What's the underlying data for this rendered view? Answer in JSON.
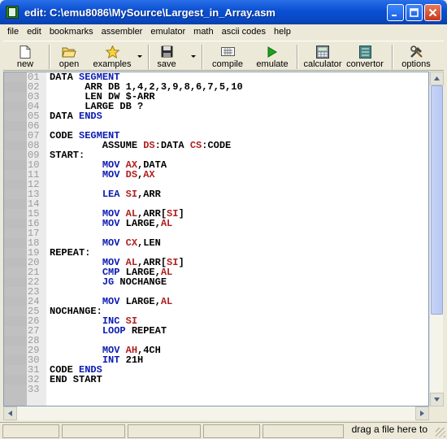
{
  "window": {
    "title": "edit: C:\\emu8086\\MySource\\Largest_in_Array.asm"
  },
  "menu": [
    "file",
    "edit",
    "bookmarks",
    "assembler",
    "emulator",
    "math",
    "ascii codes",
    "help"
  ],
  "toolbar": {
    "new": "new",
    "open": "open",
    "examples": "examples",
    "save": "save",
    "compile": "compile",
    "emulate": "emulate",
    "calculator": "calculator",
    "convertor": "convertor",
    "options": "options"
  },
  "editor": {
    "line_numbers": [
      "01",
      "02",
      "03",
      "04",
      "05",
      "06",
      "07",
      "08",
      "09",
      "10",
      "11",
      "12",
      "13",
      "14",
      "15",
      "16",
      "17",
      "18",
      "19",
      "20",
      "21",
      "22",
      "23",
      "24",
      "25",
      "26",
      "27",
      "28",
      "29",
      "30",
      "31",
      "32",
      "33"
    ],
    "lines": [
      [
        {
          "t": "DATA ",
          "c": ""
        },
        {
          "t": "SEGMENT",
          "c": "blue"
        }
      ],
      [
        {
          "t": "      ARR DB 1,4,2,3,9,8,6,7,5,10",
          "c": ""
        }
      ],
      [
        {
          "t": "      LEN DW $-ARR",
          "c": ""
        }
      ],
      [
        {
          "t": "      LARGE DB ?",
          "c": ""
        }
      ],
      [
        {
          "t": "DATA ",
          "c": ""
        },
        {
          "t": "ENDS",
          "c": "blue"
        }
      ],
      [],
      [
        {
          "t": "CODE ",
          "c": ""
        },
        {
          "t": "SEGMENT",
          "c": "blue"
        }
      ],
      [
        {
          "t": "         ASSUME ",
          "c": ""
        },
        {
          "t": "DS",
          "c": "red"
        },
        {
          "t": ":DATA ",
          "c": ""
        },
        {
          "t": "CS",
          "c": "red"
        },
        {
          "t": ":CODE",
          "c": ""
        }
      ],
      [
        {
          "t": "START:",
          "c": ""
        }
      ],
      [
        {
          "t": "         ",
          "c": ""
        },
        {
          "t": "MOV",
          "c": "blue"
        },
        {
          "t": " ",
          "c": ""
        },
        {
          "t": "AX",
          "c": "red"
        },
        {
          "t": ",DATA",
          "c": ""
        }
      ],
      [
        {
          "t": "         ",
          "c": ""
        },
        {
          "t": "MOV",
          "c": "blue"
        },
        {
          "t": " ",
          "c": ""
        },
        {
          "t": "DS",
          "c": "red"
        },
        {
          "t": ",",
          "c": ""
        },
        {
          "t": "AX",
          "c": "red"
        }
      ],
      [],
      [
        {
          "t": "         ",
          "c": ""
        },
        {
          "t": "LEA",
          "c": "blue"
        },
        {
          "t": " ",
          "c": ""
        },
        {
          "t": "SI",
          "c": "red"
        },
        {
          "t": ",ARR",
          "c": ""
        }
      ],
      [],
      [
        {
          "t": "         ",
          "c": ""
        },
        {
          "t": "MOV",
          "c": "blue"
        },
        {
          "t": " ",
          "c": ""
        },
        {
          "t": "AL",
          "c": "red"
        },
        {
          "t": ",ARR[",
          "c": ""
        },
        {
          "t": "SI",
          "c": "red"
        },
        {
          "t": "]",
          "c": ""
        }
      ],
      [
        {
          "t": "         ",
          "c": ""
        },
        {
          "t": "MOV",
          "c": "blue"
        },
        {
          "t": " LARGE,",
          "c": ""
        },
        {
          "t": "AL",
          "c": "red"
        }
      ],
      [],
      [
        {
          "t": "         ",
          "c": ""
        },
        {
          "t": "MOV",
          "c": "blue"
        },
        {
          "t": " ",
          "c": ""
        },
        {
          "t": "CX",
          "c": "red"
        },
        {
          "t": ",LEN",
          "c": ""
        }
      ],
      [
        {
          "t": "REPEAT:",
          "c": ""
        }
      ],
      [
        {
          "t": "         ",
          "c": ""
        },
        {
          "t": "MOV",
          "c": "blue"
        },
        {
          "t": " ",
          "c": ""
        },
        {
          "t": "AL",
          "c": "red"
        },
        {
          "t": ",ARR[",
          "c": ""
        },
        {
          "t": "SI",
          "c": "red"
        },
        {
          "t": "]",
          "c": ""
        }
      ],
      [
        {
          "t": "         ",
          "c": ""
        },
        {
          "t": "CMP",
          "c": "blue"
        },
        {
          "t": " LARGE,",
          "c": ""
        },
        {
          "t": "AL",
          "c": "red"
        }
      ],
      [
        {
          "t": "         ",
          "c": ""
        },
        {
          "t": "JG",
          "c": "blue"
        },
        {
          "t": " NOCHANGE",
          "c": ""
        }
      ],
      [],
      [
        {
          "t": "         ",
          "c": ""
        },
        {
          "t": "MOV",
          "c": "blue"
        },
        {
          "t": " LARGE,",
          "c": ""
        },
        {
          "t": "AL",
          "c": "red"
        }
      ],
      [
        {
          "t": "NOCHANGE:",
          "c": ""
        }
      ],
      [
        {
          "t": "         ",
          "c": ""
        },
        {
          "t": "INC",
          "c": "blue"
        },
        {
          "t": " ",
          "c": ""
        },
        {
          "t": "SI",
          "c": "red"
        }
      ],
      [
        {
          "t": "         ",
          "c": ""
        },
        {
          "t": "LOOP",
          "c": "blue"
        },
        {
          "t": " REPEAT",
          "c": ""
        }
      ],
      [],
      [
        {
          "t": "         ",
          "c": ""
        },
        {
          "t": "MOV",
          "c": "blue"
        },
        {
          "t": " ",
          "c": ""
        },
        {
          "t": "AH",
          "c": "red"
        },
        {
          "t": ",4CH",
          "c": ""
        }
      ],
      [
        {
          "t": "         ",
          "c": ""
        },
        {
          "t": "INT",
          "c": "blue"
        },
        {
          "t": " 21H",
          "c": ""
        }
      ],
      [
        {
          "t": "CODE ",
          "c": ""
        },
        {
          "t": "ENDS",
          "c": "blue"
        }
      ],
      [
        {
          "t": "END START",
          "c": ""
        }
      ],
      []
    ]
  },
  "statusbar": {
    "hint": "drag a file here to"
  },
  "colors": {
    "keyword": "#1010c8",
    "register": "#c01818",
    "gutter": "#c0c0c0",
    "titlebar": "#0848c4"
  }
}
